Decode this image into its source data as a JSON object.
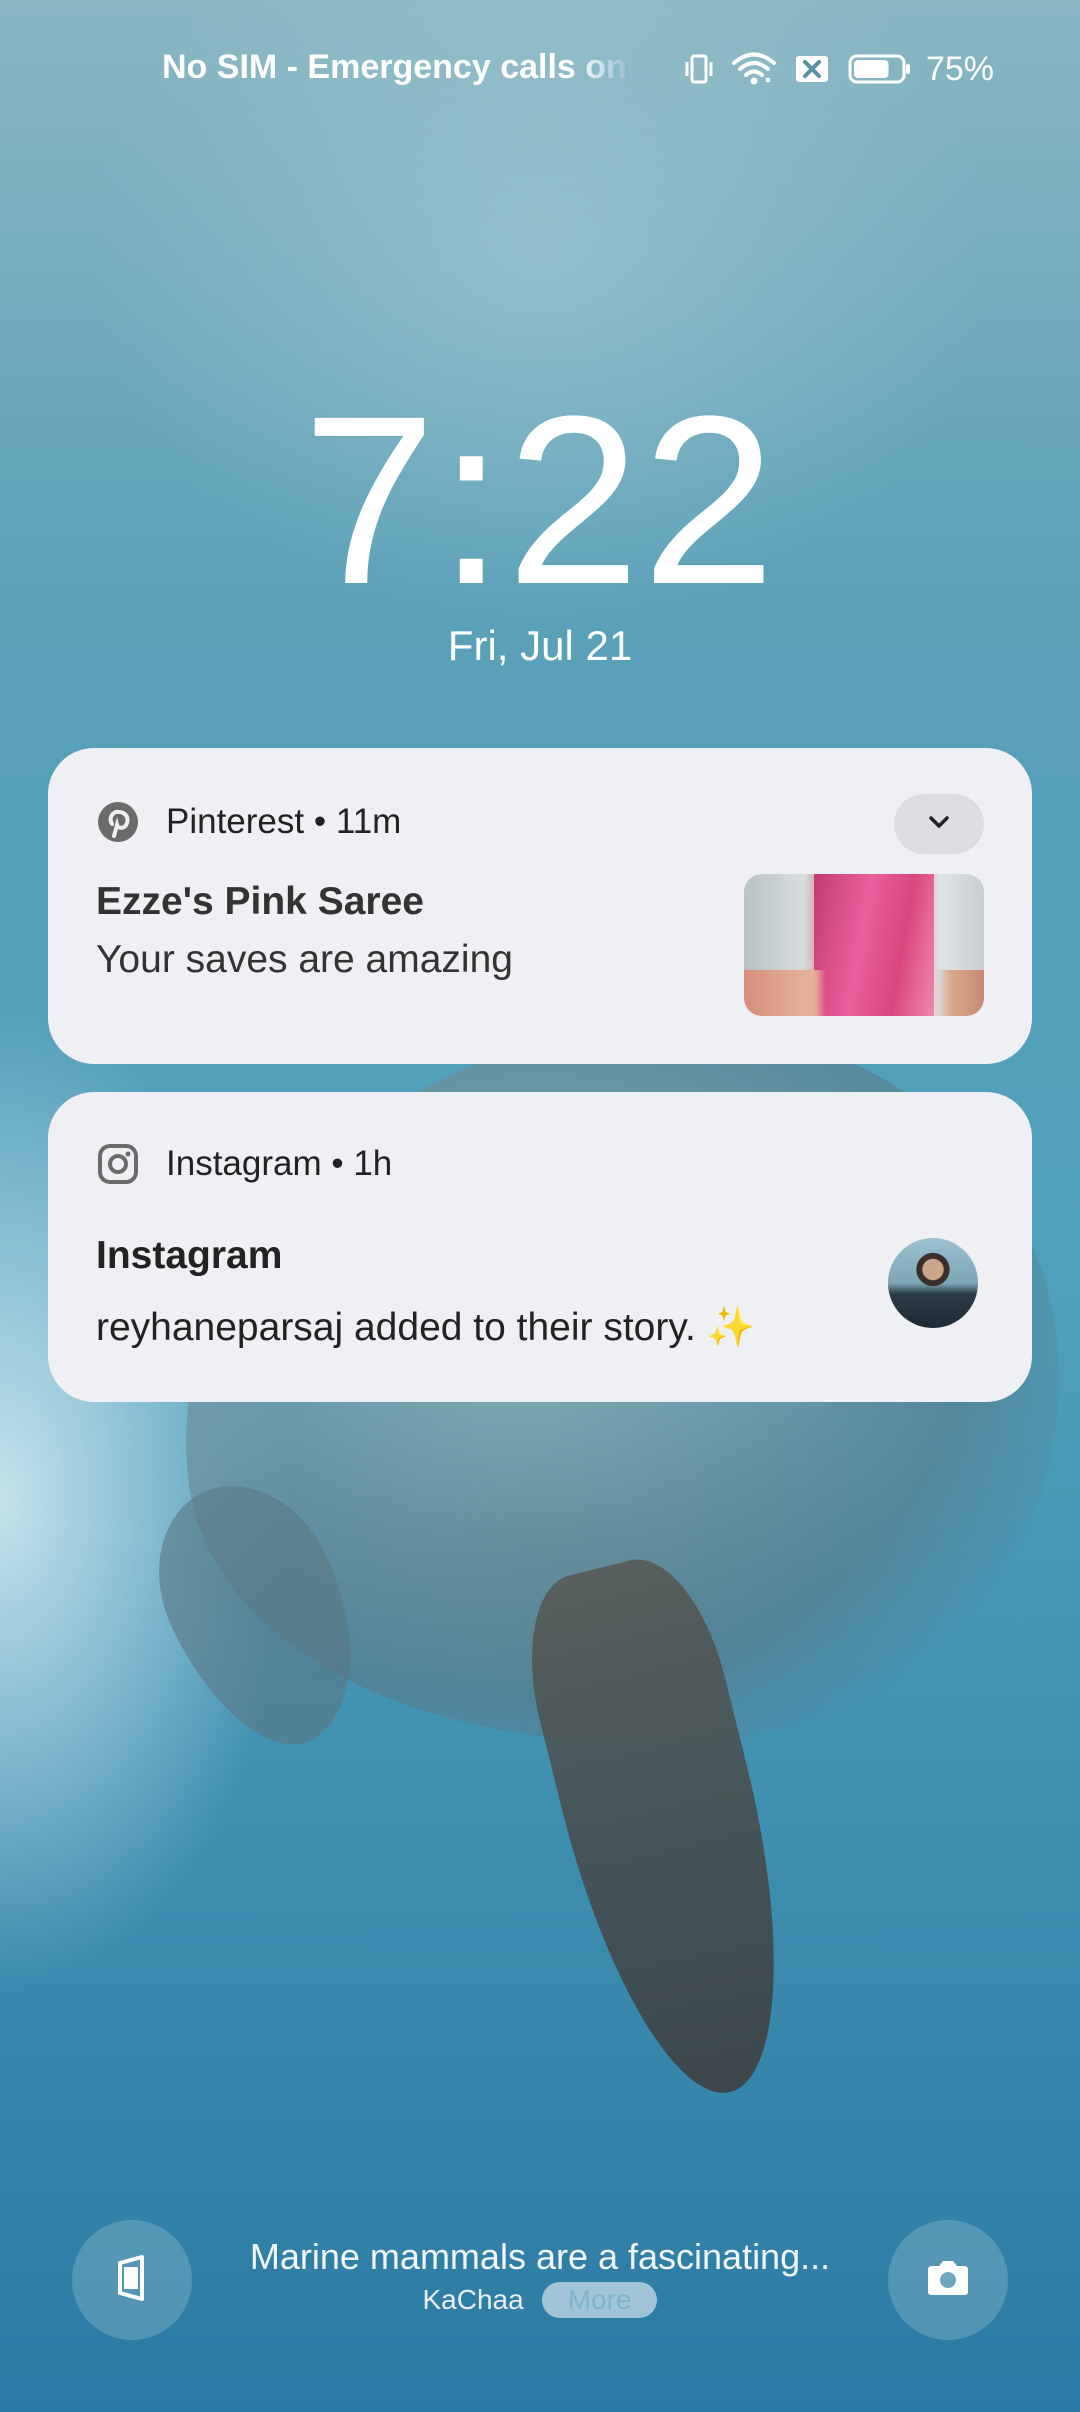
{
  "status_bar": {
    "carrier": "No SIM - Emergency calls only",
    "battery_percent": "75%",
    "battery_level": 0.75,
    "icons": [
      "vibrate-icon",
      "wifi-icon",
      "no-sim-icon",
      "battery-icon"
    ]
  },
  "lock_screen": {
    "time": "7:22",
    "date": "Fri, Jul 21"
  },
  "notifications": [
    {
      "app": "Pinterest",
      "meta": "• 11m",
      "title": "Ezze's Pink Saree",
      "text": "Your saves are amazing",
      "icon": "pinterest-icon"
    },
    {
      "app": "Instagram",
      "meta": "• 1h",
      "title": "Instagram",
      "text": "reyhaneparsaj added to their story. ✨",
      "icon": "instagram-icon"
    }
  ],
  "bottom": {
    "caption": "Marine mammals are a fascinating...",
    "source": "KaChaa",
    "more_label": "More",
    "left_icon": "wallpaper-carousel-icon",
    "right_icon": "camera-icon"
  }
}
